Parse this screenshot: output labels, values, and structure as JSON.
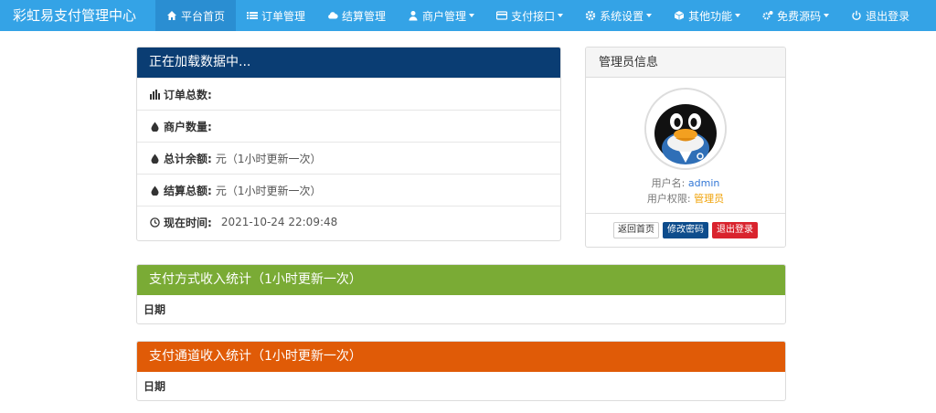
{
  "navbar": {
    "brand": "彩虹易支付管理中心",
    "items": [
      {
        "label": "平台首页",
        "icon": "home-icon",
        "active": true,
        "dropdown": false
      },
      {
        "label": "订单管理",
        "icon": "list-icon",
        "active": false,
        "dropdown": false
      },
      {
        "label": "结算管理",
        "icon": "cloud-icon",
        "active": false,
        "dropdown": false
      },
      {
        "label": "商户管理",
        "icon": "user-icon",
        "active": false,
        "dropdown": true
      },
      {
        "label": "支付接口",
        "icon": "credit-card-icon",
        "active": false,
        "dropdown": true
      },
      {
        "label": "系统设置",
        "icon": "gear-icon",
        "active": false,
        "dropdown": true
      },
      {
        "label": "其他功能",
        "icon": "cube-icon",
        "active": false,
        "dropdown": true
      },
      {
        "label": "免费源码",
        "icon": "gears-icon",
        "active": false,
        "dropdown": true
      },
      {
        "label": "退出登录",
        "icon": "power-icon",
        "active": false,
        "dropdown": false
      }
    ]
  },
  "stats": {
    "heading": "正在加载数据中...",
    "rows": [
      {
        "icon": "bar-chart-icon",
        "label": "订单总数:",
        "value": ""
      },
      {
        "icon": "drop-icon",
        "label": "商户数量:",
        "value": ""
      },
      {
        "icon": "drop-icon",
        "label": "总计余额:",
        "value": "元（1小时更新一次）"
      },
      {
        "icon": "drop-icon",
        "label": "结算总额:",
        "value": "元（1小时更新一次）"
      },
      {
        "icon": "clock-icon",
        "label": "现在时间:",
        "value": "2021-10-24 22:09:48"
      }
    ]
  },
  "admin": {
    "heading": "管理员信息",
    "username_label": "用户名:",
    "username": "admin",
    "role_label": "用户权限:",
    "role": "管理员",
    "buttons": {
      "home": "返回首页",
      "password": "修改密码",
      "logout": "退出登录"
    }
  },
  "payment_method": {
    "heading": "支付方式收入统计（1小时更新一次）",
    "column": "日期"
  },
  "payment_channel": {
    "heading": "支付通道收入统计（1小时更新一次）",
    "column": "日期"
  },
  "colors": {
    "navbar": "#34a3e6",
    "stats_heading": "#0a3d73",
    "method_heading": "#7aab35",
    "channel_heading": "#e05b07"
  }
}
